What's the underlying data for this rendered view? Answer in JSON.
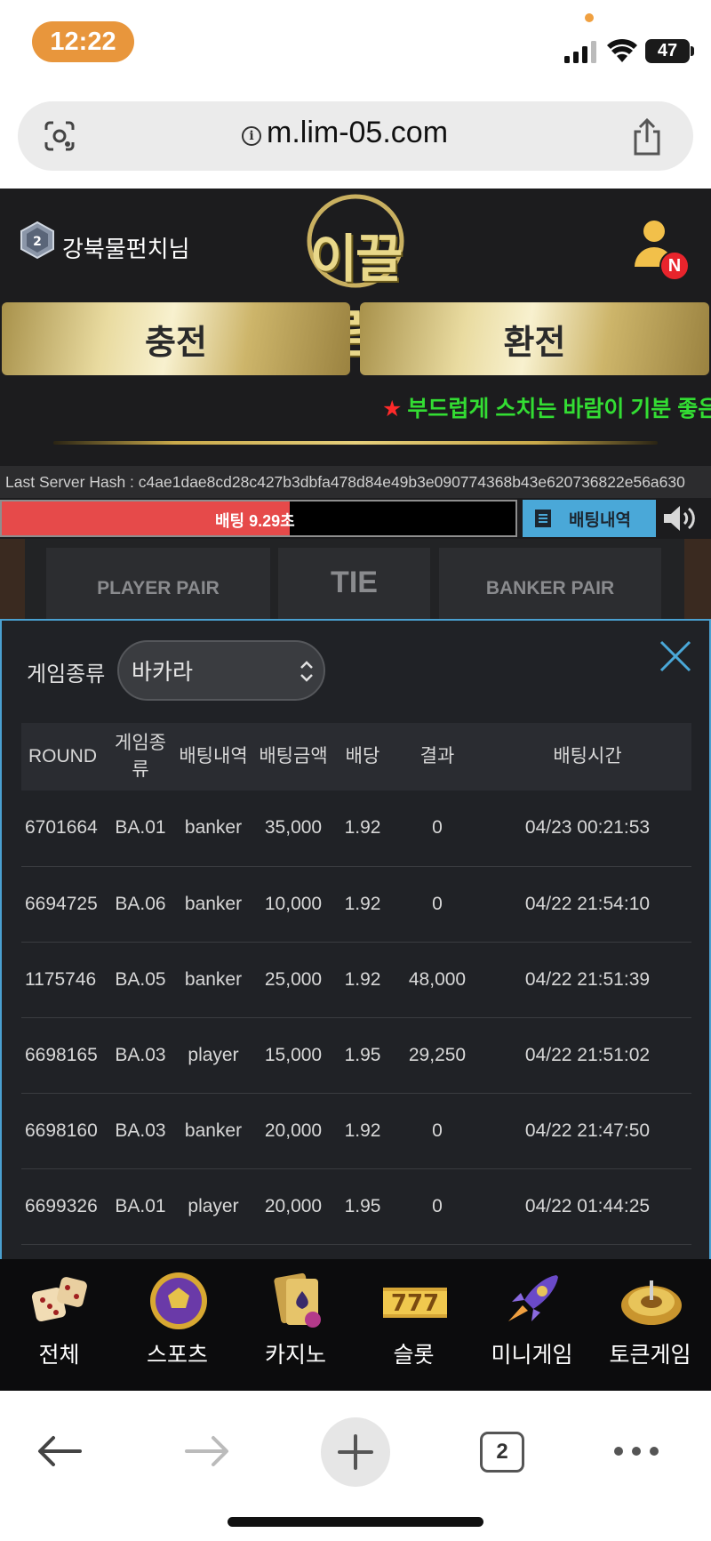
{
  "status_bar": {
    "time": "12:22",
    "battery": "47"
  },
  "browser": {
    "url": "m.lim-05.com",
    "tab_count": "2"
  },
  "header": {
    "username": "강북물펀치님",
    "logo_text": "이끌림",
    "notification_badge": "N"
  },
  "actions": {
    "charge_label": "충전",
    "exchange_label": "환전"
  },
  "marquee": {
    "star": "★",
    "text": "부드럽게 스치는 바람이 기분 좋은"
  },
  "hash": {
    "text": "Last Server Hash : c4ae1dae8cd28c427b3dbfa478d84e49b3e090774368b43e620736822e56a630"
  },
  "betting": {
    "timer_label": "배팅 9.29초",
    "timer_fraction": 0.56,
    "history_label": "배팅내역"
  },
  "board": {
    "player_pair": "PLAYER PAIR",
    "tie": "TIE",
    "banker_pair": "BANKER PAIR"
  },
  "modal": {
    "filter_label": "게임종류",
    "filter_value": "바카라",
    "columns": [
      "ROUND",
      "게임종류",
      "배팅내역",
      "배팅금액",
      "배당",
      "결과",
      "배팅시간"
    ],
    "rows": [
      [
        "6701664",
        "BA.01",
        "banker",
        "35,000",
        "1.92",
        "0",
        "04/23 00:21:53"
      ],
      [
        "6694725",
        "BA.06",
        "banker",
        "10,000",
        "1.92",
        "0",
        "04/22 21:54:10"
      ],
      [
        "1175746",
        "BA.05",
        "banker",
        "25,000",
        "1.92",
        "48,000",
        "04/22 21:51:39"
      ],
      [
        "6698165",
        "BA.03",
        "player",
        "15,000",
        "1.95",
        "29,250",
        "04/22 21:51:02"
      ],
      [
        "6698160",
        "BA.03",
        "banker",
        "20,000",
        "1.92",
        "0",
        "04/22 21:47:50"
      ],
      [
        "6699326",
        "BA.01",
        "player",
        "20,000",
        "1.95",
        "0",
        "04/22 01:44:25"
      ]
    ]
  },
  "game_nav": [
    {
      "label": "전체",
      "icon": "dice-icon"
    },
    {
      "label": "스포츠",
      "icon": "soccer-ball-icon"
    },
    {
      "label": "카지노",
      "icon": "cards-icon"
    },
    {
      "label": "슬롯",
      "icon": "slot-777-icon"
    },
    {
      "label": "미니게임",
      "icon": "rocket-icon"
    },
    {
      "label": "토큰게임",
      "icon": "roulette-icon"
    }
  ],
  "colors": {
    "accent_gold": "#e9d88a",
    "marquee_green": "#33dd33",
    "timer_red": "#e64a4a",
    "history_blue": "#4aa8d8",
    "time_pill": "#e8963c"
  }
}
